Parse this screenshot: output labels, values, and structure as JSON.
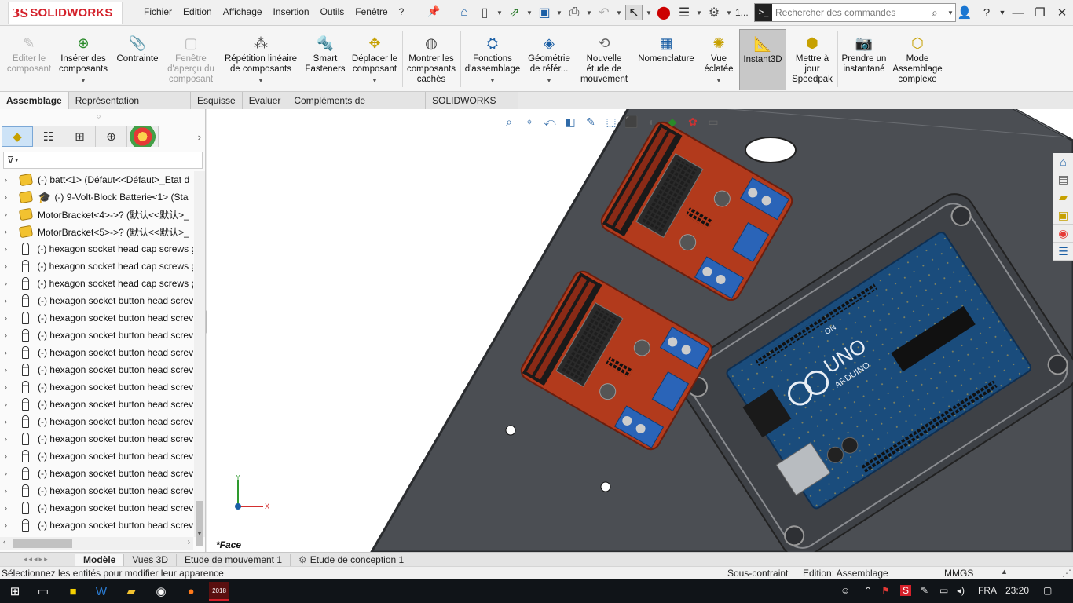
{
  "title_bar": {
    "logo_ds": "3S",
    "logo_text": "SOLIDWORKS",
    "menu": [
      "Fichier",
      "Edition",
      "Affichage",
      "Insertion",
      "Outils",
      "Fenêtre",
      "?"
    ],
    "pin_icon": "pin-icon",
    "quick_access": [
      "home-icon",
      "new-document-icon",
      "open-icon",
      "save-icon",
      "print-icon",
      "undo-icon",
      "select-icon",
      "rebuild-icon",
      "file-properties-icon",
      "options-icon"
    ],
    "ellipsis": "1...",
    "search_placeholder": "Rechercher des commandes",
    "help_label": "?",
    "window_controls": [
      "minimize",
      "restore",
      "close"
    ]
  },
  "ribbon": {
    "buttons": [
      {
        "label": "Editer le composant",
        "icon": "edit-component-icon",
        "enabled": false,
        "has_arrow": false
      },
      {
        "label": "Insérer des composants",
        "icon": "insert-components-icon",
        "enabled": true,
        "has_arrow": true
      },
      {
        "label": "Contrainte",
        "icon": "mate-paperclip-icon",
        "enabled": true,
        "has_arrow": false
      },
      {
        "label": "Fenêtre d'aperçu du composant",
        "icon": "component-preview-window-icon",
        "enabled": false,
        "has_arrow": false
      },
      {
        "label": "Répétition linéaire de composants",
        "icon": "linear-pattern-icon",
        "enabled": true,
        "has_arrow": true
      },
      {
        "label": "Smart Fasteners",
        "icon": "smart-fasteners-icon",
        "enabled": true,
        "has_arrow": false
      },
      {
        "label": "Déplacer le composant",
        "icon": "move-component-icon",
        "enabled": true,
        "has_arrow": true
      },
      {
        "label": "Montrer les composants cachés",
        "icon": "show-hidden-components-icon",
        "enabled": true,
        "has_arrow": false
      },
      {
        "label": "Fonctions d'assemblage",
        "icon": "assembly-features-icon",
        "enabled": true,
        "has_arrow": true
      },
      {
        "label": "Géométrie de référ...",
        "icon": "reference-geometry-icon",
        "enabled": true,
        "has_arrow": true
      },
      {
        "label": "Nouvelle étude de mouvement",
        "icon": "new-motion-study-icon",
        "enabled": true,
        "has_arrow": false
      },
      {
        "label": "Nomenclature",
        "icon": "bill-of-materials-icon",
        "enabled": true,
        "has_arrow": false
      },
      {
        "label": "Vue éclatée",
        "icon": "exploded-view-icon",
        "enabled": true,
        "has_arrow": true
      },
      {
        "label": "Instant3D",
        "icon": "instant3d-icon",
        "enabled": true,
        "has_arrow": false,
        "active": true
      },
      {
        "label": "Mettre à jour Speedpak",
        "icon": "update-speedpak-icon",
        "enabled": true,
        "has_arrow": false
      },
      {
        "label": "Prendre un instantané",
        "icon": "take-snapshot-icon",
        "enabled": true,
        "has_arrow": false
      },
      {
        "label": "Mode Assemblage complexe",
        "icon": "large-assembly-mode-icon",
        "enabled": true,
        "has_arrow": false
      }
    ]
  },
  "command_tabs": [
    "Assemblage",
    "Représentation schématique",
    "Esquisse",
    "Evaluer",
    "Compléments de SOLIDWORKS",
    "SOLIDWORKS MBD"
  ],
  "active_command_tab": "Assemblage",
  "feature_manager": {
    "tabs": [
      "feature-manager-icon",
      "property-manager-icon",
      "configuration-manager-icon",
      "dimxpert-icon",
      "display-manager-icon"
    ],
    "tree_items": [
      {
        "label": "(-) batt<1> (Défaut<<Défaut>_Etat d",
        "icon": "assembly"
      },
      {
        "label": "(-) 9-Volt-Block Batterie<1> (Sta",
        "icon": "assembly-student"
      },
      {
        "label": "MotorBracket<4>->? (默认<<默认>_",
        "icon": "assembly"
      },
      {
        "label": "MotorBracket<5>->? (默认<<默认>_",
        "icon": "assembly"
      },
      {
        "label": "(-) hexagon socket head cap screws g",
        "icon": "screw"
      },
      {
        "label": "(-) hexagon socket head cap screws g",
        "icon": "screw"
      },
      {
        "label": "(-) hexagon socket head cap screws g",
        "icon": "screw"
      },
      {
        "label": "(-) hexagon socket button head screv",
        "icon": "screw"
      },
      {
        "label": "(-) hexagon socket button head screv",
        "icon": "screw"
      },
      {
        "label": "(-) hexagon socket button head screv",
        "icon": "screw"
      },
      {
        "label": "(-) hexagon socket button head screv",
        "icon": "screw"
      },
      {
        "label": "(-) hexagon socket button head screv",
        "icon": "screw"
      },
      {
        "label": "(-) hexagon socket button head screv",
        "icon": "screw"
      },
      {
        "label": "(-) hexagon socket button head screv",
        "icon": "screw"
      },
      {
        "label": "(-) hexagon socket button head screv",
        "icon": "screw"
      },
      {
        "label": "(-) hexagon socket button head screv",
        "icon": "screw"
      },
      {
        "label": "(-) hexagon socket button head screv",
        "icon": "screw"
      },
      {
        "label": "(-) hexagon socket button head screv",
        "icon": "screw"
      },
      {
        "label": "(-) hexagon socket button head screv",
        "icon": "screw"
      },
      {
        "label": "(-) hexagon socket button head screv",
        "icon": "screw"
      },
      {
        "label": "(-) hexagon socket button head screv",
        "icon": "screw"
      },
      {
        "label": "(-) hexagon socket button head screv",
        "icon": "screw"
      }
    ]
  },
  "viewport": {
    "view_label": "*Face",
    "board_labels": {
      "uno": "UNO",
      "arduino": "ARDUINO",
      "on": "ON"
    },
    "triad": {
      "x": "X",
      "y": "Y"
    }
  },
  "bottom_tabs": [
    "Modèle",
    "Vues 3D",
    "Etude de mouvement 1",
    "Etude de conception 1"
  ],
  "active_bottom_tab": "Modèle",
  "status_bar": {
    "message": "Sélectionnez les entités pour modifier leur apparence",
    "constraint_state": "Sous-contraint",
    "edit_mode": "Edition: Assemblage",
    "units": "MMGS"
  },
  "taskbar": {
    "apps": [
      "windows-start-icon",
      "task-view-icon",
      "sticky-notes-icon",
      "word-icon",
      "file-explorer-icon",
      "app-icon",
      "firefox-icon",
      "solidworks-2018-icon"
    ],
    "sw_badge": "2018",
    "language": "FRA",
    "time": "23:20"
  },
  "colors": {
    "accent": "#1b5fa5",
    "brand_red": "#d4202a",
    "plate": "#4a4d52",
    "driver_board": "#b23a1c",
    "arduino_blue": "#1a4c7c"
  }
}
